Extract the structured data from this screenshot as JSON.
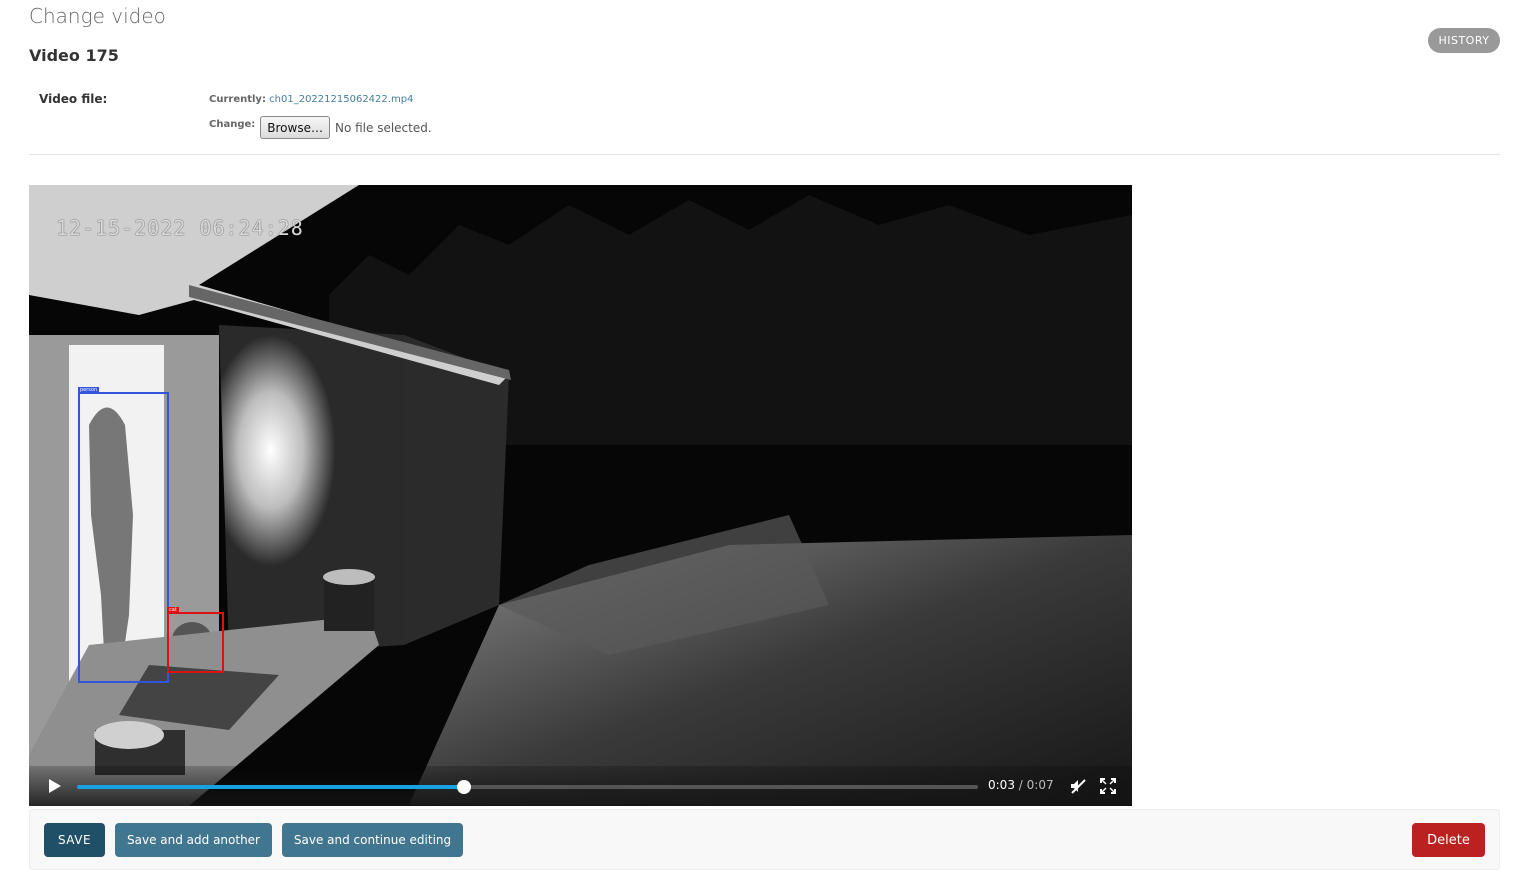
{
  "page": {
    "title": "Change video",
    "object_title": "Video 175",
    "history_label": "HISTORY"
  },
  "form": {
    "video_file": {
      "label": "Video file:",
      "currently_label": "Currently:",
      "current_file": "ch01_20221215062422.mp4",
      "change_label": "Change:",
      "browse_label": "Browse…",
      "no_file_text": "No file selected."
    }
  },
  "video": {
    "timestamp_overlay": "12-15-2022 06:24:28",
    "detections": [
      {
        "label": "person",
        "color": "#3355dd"
      },
      {
        "label": "cat",
        "color": "#dd1111"
      }
    ],
    "player": {
      "current_time": "0:03",
      "separator": "/",
      "duration": "0:07",
      "progress_fraction": 0.43,
      "muted": true,
      "icons": [
        "play-icon",
        "muted-speaker-icon",
        "fullscreen-icon"
      ]
    }
  },
  "actions": {
    "save": "SAVE",
    "save_add_another": "Save and add another",
    "save_continue": "Save and continue editing",
    "delete": "Delete"
  },
  "colors": {
    "primary_dark": "#205067",
    "primary": "#417690",
    "danger": "#ba2121",
    "progress": "#19a1e6",
    "link": "#447e9b"
  }
}
